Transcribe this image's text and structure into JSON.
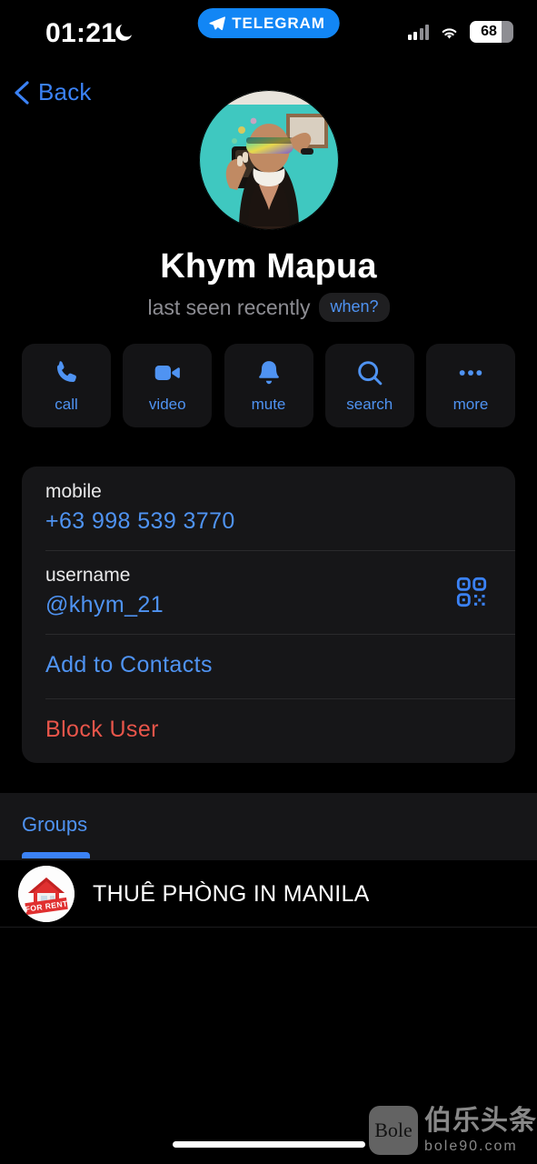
{
  "status_bar": {
    "time": "01:21",
    "dnd_icon": "moon-icon",
    "dynamic_island_label": "TELEGRAM",
    "dynamic_island_icon": "telegram-plane-icon",
    "signal_icon": "cellular-signal-icon",
    "wifi_icon": "wifi-icon",
    "battery_level": "68",
    "battery_icon": "battery-icon"
  },
  "nav": {
    "back_label": "Back",
    "back_icon": "chevron-left-icon"
  },
  "profile": {
    "avatar_name": "profile-avatar",
    "name": "Khym Mapua",
    "status": "last seen recently",
    "when_badge": "when?"
  },
  "actions": [
    {
      "label": "call",
      "icon": "phone-icon"
    },
    {
      "label": "video",
      "icon": "video-camera-icon"
    },
    {
      "label": "mute",
      "icon": "bell-icon"
    },
    {
      "label": "search",
      "icon": "magnifier-icon"
    },
    {
      "label": "more",
      "icon": "ellipsis-icon"
    }
  ],
  "info_card": {
    "mobile_label": "mobile",
    "mobile_value": "+63 998 539 3770",
    "username_label": "username",
    "username_value": "@khym_21",
    "qr_icon": "qr-code-icon",
    "add_contacts_label": "Add to Contacts",
    "block_user_label": "Block User"
  },
  "groups_section": {
    "tab_label": "Groups",
    "items": [
      {
        "name": "THUÊ PHÒNG IN MANILA",
        "avatar": "for-rent-house-avatar"
      }
    ]
  },
  "watermark": {
    "badge": "Bole",
    "cn": "伯乐头条",
    "url": "bole90.com"
  },
  "colors": {
    "accent_blue": "#4f93f2",
    "link_blue": "#3b82f6",
    "destructive_red": "#e8554a",
    "card_bg": "#161618",
    "page_bg": "#000000"
  }
}
